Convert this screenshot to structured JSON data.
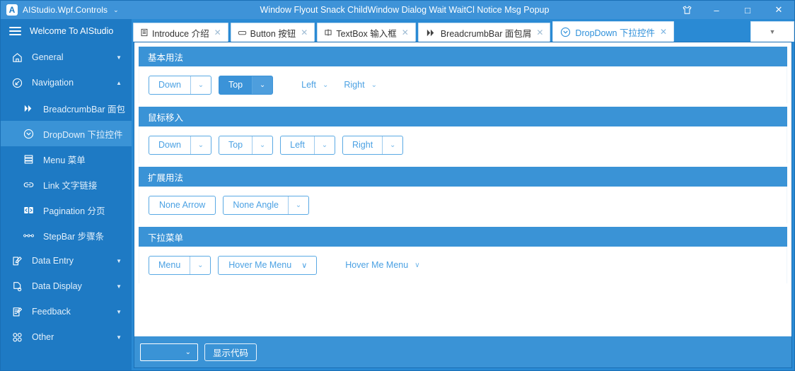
{
  "titlebar": {
    "app_name": "AIStudio.Wpf.Controls",
    "caret": "⌄",
    "window_title": "Window Flyout Snack ChildWindow Dialog Wait WaitCl Notice Msg Popup",
    "logo_letter": "A",
    "theme_icon": "tshirt-icon",
    "minimize": "–",
    "maximize": "□",
    "close": "✕",
    "accent": "#3e93d8"
  },
  "sidebar": {
    "header": "Welcome To AIStudio",
    "items": [
      {
        "label": "General",
        "icon": "home-icon",
        "level": 0,
        "arrow": "▼",
        "active": false
      },
      {
        "label": "Navigation",
        "icon": "navigation-icon",
        "level": 0,
        "arrow": "▲",
        "active": false
      },
      {
        "label": "BreadcrumbBar 面包",
        "icon": "breadcrumb-icon",
        "level": 1,
        "arrow": "",
        "active": false
      },
      {
        "label": "DropDown 下拉控件",
        "icon": "dropdown-icon",
        "level": 1,
        "arrow": "",
        "active": true
      },
      {
        "label": "Menu 菜单",
        "icon": "menu-icon",
        "level": 1,
        "arrow": "",
        "active": false
      },
      {
        "label": "Link 文字链接",
        "icon": "link-icon",
        "level": 1,
        "arrow": "",
        "active": false
      },
      {
        "label": "Pagination 分页",
        "icon": "pagination-icon",
        "level": 1,
        "arrow": "",
        "active": false
      },
      {
        "label": "StepBar 步骤条",
        "icon": "stepbar-icon",
        "level": 1,
        "arrow": "",
        "active": false
      },
      {
        "label": "Data Entry",
        "icon": "data-entry-icon",
        "level": 0,
        "arrow": "▼",
        "active": false
      },
      {
        "label": "Data Display",
        "icon": "data-display-icon",
        "level": 0,
        "arrow": "▼",
        "active": false
      },
      {
        "label": "Feedback",
        "icon": "feedback-icon",
        "level": 0,
        "arrow": "▼",
        "active": false
      },
      {
        "label": "Other",
        "icon": "other-icon",
        "level": 0,
        "arrow": "▼",
        "active": false
      }
    ]
  },
  "tabs": [
    {
      "label": "Introduce 介绍",
      "icon": "document-icon",
      "close": "✕",
      "active": false
    },
    {
      "label": "Button 按钮",
      "icon": "button-icon",
      "close": "✕",
      "active": false
    },
    {
      "label": "TextBox 输入框",
      "icon": "textbox-icon",
      "close": "✕",
      "active": false
    },
    {
      "label": "BreadcrumbBar 面包屑",
      "icon": "breadcrumb-icon",
      "close": "✕",
      "active": false
    },
    {
      "label": "DropDown 下拉控件",
      "icon": "dropdown-icon",
      "close": "✕",
      "active": true
    }
  ],
  "tab_overflow_icon": "chevron-down-icon",
  "sections": [
    {
      "title": "基本用法",
      "controls": [
        {
          "kind": "split",
          "label": "Down",
          "arrow": "⌄",
          "style": "outline"
        },
        {
          "kind": "split",
          "label": "Top",
          "arrow": "⌄",
          "style": "solid"
        },
        {
          "kind": "flat",
          "label": "Left",
          "arrow": "⌄",
          "style": "flat"
        },
        {
          "kind": "flat",
          "label": "Right",
          "arrow": "⌄",
          "style": "flat"
        }
      ]
    },
    {
      "title": "鼠标移入",
      "controls": [
        {
          "kind": "split",
          "label": "Down",
          "arrow": "⌄",
          "style": "outline"
        },
        {
          "kind": "split",
          "label": "Top",
          "arrow": "⌄",
          "style": "outline"
        },
        {
          "kind": "split",
          "label": "Left",
          "arrow": "⌄",
          "style": "outline"
        },
        {
          "kind": "split",
          "label": "Right",
          "arrow": "⌄",
          "style": "outline"
        }
      ]
    },
    {
      "title": "扩展用法",
      "controls": [
        {
          "kind": "button",
          "label": "None Arrow",
          "arrow": "",
          "style": "outline"
        },
        {
          "kind": "split",
          "label": "None Angle",
          "arrow": "⌄",
          "style": "outline"
        }
      ]
    },
    {
      "title": "下拉菜单",
      "controls": [
        {
          "kind": "split",
          "label": "Menu",
          "arrow": "⌄",
          "style": "outline"
        },
        {
          "kind": "inlinebtn",
          "label": "Hover Me Menu",
          "arrow": "∨",
          "style": "outline"
        },
        {
          "kind": "flat",
          "label": "Hover Me Menu",
          "arrow": "∨",
          "style": "flat"
        }
      ]
    }
  ],
  "bottombar": {
    "combo_value": "",
    "combo_arrow": "⌄",
    "show_code_label": "显示代码"
  }
}
